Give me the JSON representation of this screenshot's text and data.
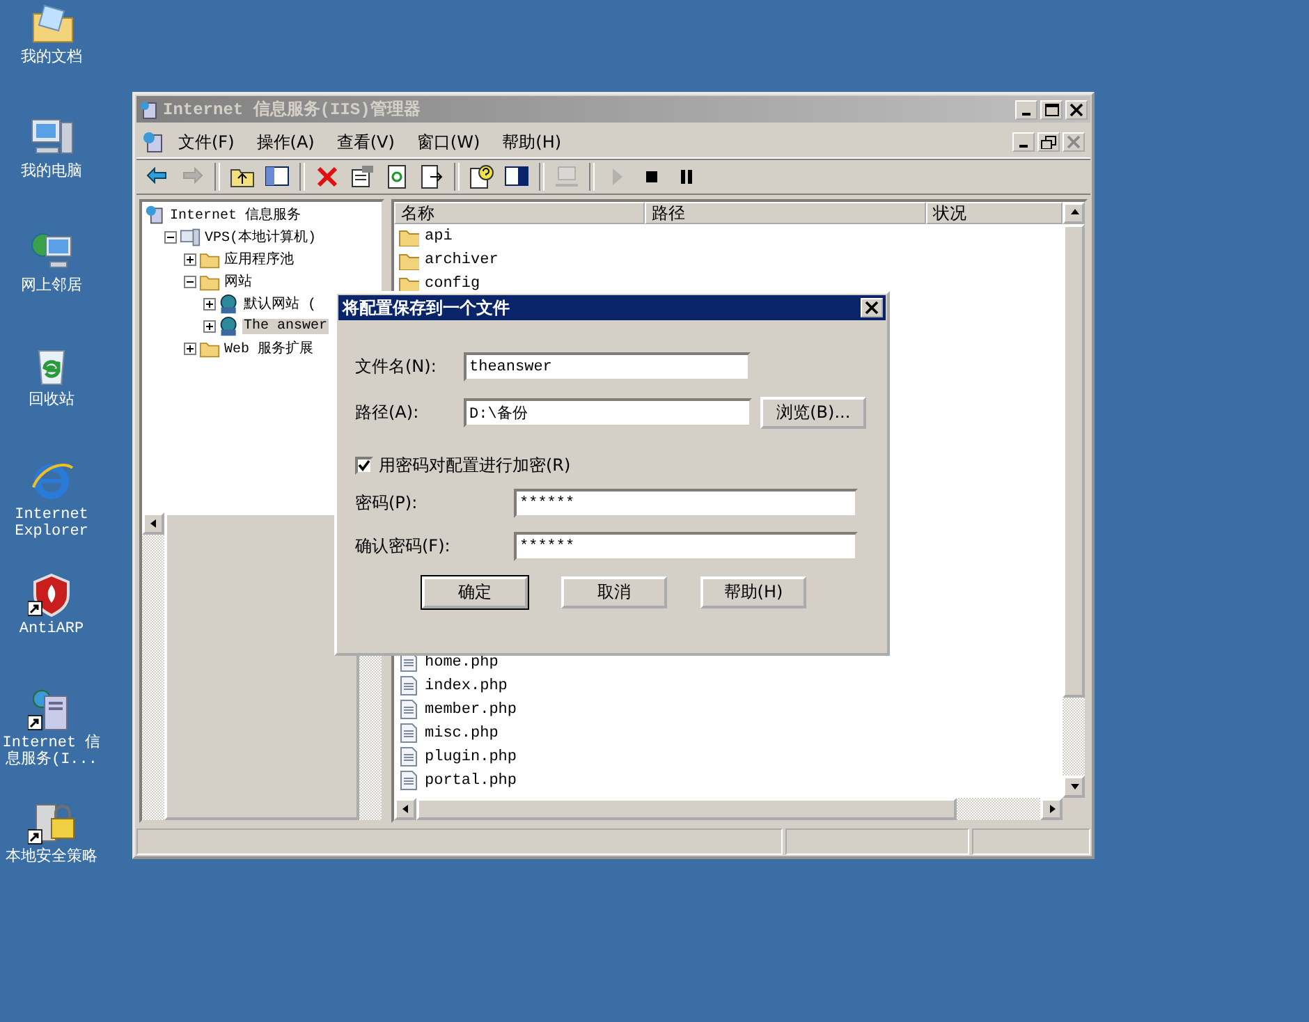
{
  "desktop_icons": [
    {
      "label": "我的文档",
      "kind": "documents",
      "shortcut": false
    },
    {
      "label": "我的电脑",
      "kind": "computer",
      "shortcut": false
    },
    {
      "label": "网上邻居",
      "kind": "network",
      "shortcut": false
    },
    {
      "label": "回收站",
      "kind": "recycle",
      "shortcut": false
    },
    {
      "label": "Internet Explorer",
      "kind": "browser",
      "shortcut": false
    },
    {
      "label": "AntiARP",
      "kind": "shield",
      "shortcut": true
    },
    {
      "label": "Internet 信息服务(I...",
      "kind": "server",
      "shortcut": true
    },
    {
      "label": "本地安全策略",
      "kind": "lock",
      "shortcut": true
    }
  ],
  "window": {
    "title": "Internet 信息服务(IIS)管理器",
    "active": false,
    "menu": [
      "文件(F)",
      "操作(A)",
      "查看(V)",
      "窗口(W)",
      "帮助(H)"
    ],
    "toolbar": [
      {
        "kind": "back",
        "disabled": false
      },
      {
        "kind": "forward",
        "disabled": true
      },
      {
        "kind": "sep"
      },
      {
        "kind": "up",
        "disabled": false
      },
      {
        "kind": "tree",
        "disabled": false
      },
      {
        "kind": "sep"
      },
      {
        "kind": "delete",
        "disabled": false
      },
      {
        "kind": "properties",
        "disabled": false
      },
      {
        "kind": "refresh",
        "disabled": false
      },
      {
        "kind": "export",
        "disabled": false
      },
      {
        "kind": "sep"
      },
      {
        "kind": "help",
        "disabled": false
      },
      {
        "kind": "console",
        "disabled": false
      },
      {
        "kind": "sep"
      },
      {
        "kind": "computer",
        "disabled": true
      },
      {
        "kind": "sep"
      },
      {
        "kind": "play",
        "disabled": true
      },
      {
        "kind": "stop",
        "disabled": false
      },
      {
        "kind": "pause",
        "disabled": false
      }
    ],
    "tree": [
      {
        "label": "Internet 信息服务",
        "kind": "root",
        "selected": false,
        "children": [
          {
            "label": "VPS(本地计算机)",
            "kind": "computer",
            "expanded": true,
            "selected": false,
            "children": [
              {
                "label": "应用程序池",
                "kind": "folder",
                "expanded": false,
                "selected": false
              },
              {
                "label": "网站",
                "kind": "folder",
                "expanded": true,
                "selected": false,
                "children": [
                  {
                    "label": "默认网站 (",
                    "kind": "site",
                    "expanded": false,
                    "selected": false
                  },
                  {
                    "label": "The answer",
                    "kind": "site",
                    "expanded": false,
                    "selected": true
                  }
                ]
              },
              {
                "label": "Web 服务扩展",
                "kind": "folder",
                "expanded": false,
                "selected": false
              }
            ]
          }
        ]
      }
    ],
    "list": {
      "columns": [
        "名称",
        "路径",
        "状况"
      ],
      "rows_top": [
        {
          "name": "api",
          "kind": "folder"
        },
        {
          "name": "archiver",
          "kind": "folder"
        },
        {
          "name": "config",
          "kind": "folder"
        }
      ],
      "rows_bottom": [
        {
          "name": "home.php",
          "kind": "file"
        },
        {
          "name": "index.php",
          "kind": "file"
        },
        {
          "name": "member.php",
          "kind": "file"
        },
        {
          "name": "misc.php",
          "kind": "file"
        },
        {
          "name": "plugin.php",
          "kind": "file"
        },
        {
          "name": "portal.php",
          "kind": "file"
        }
      ]
    }
  },
  "dialog": {
    "title": "将配置保存到一个文件",
    "file_name": {
      "label": "文件名(N):",
      "value": "theanswer"
    },
    "path": {
      "label": "路径(A):",
      "value": "D:\\备份",
      "browse": "浏览(B)..."
    },
    "encrypt": {
      "label": "用密码对配置进行加密(R)",
      "checked": true
    },
    "password": {
      "label": "密码(P):",
      "value": "******"
    },
    "confirm": {
      "label": "确认密码(F):",
      "value": "******"
    },
    "buttons": [
      {
        "label": "确定",
        "default": true
      },
      {
        "label": "取消",
        "default": false
      },
      {
        "label": "帮助(H)",
        "default": false
      }
    ]
  }
}
